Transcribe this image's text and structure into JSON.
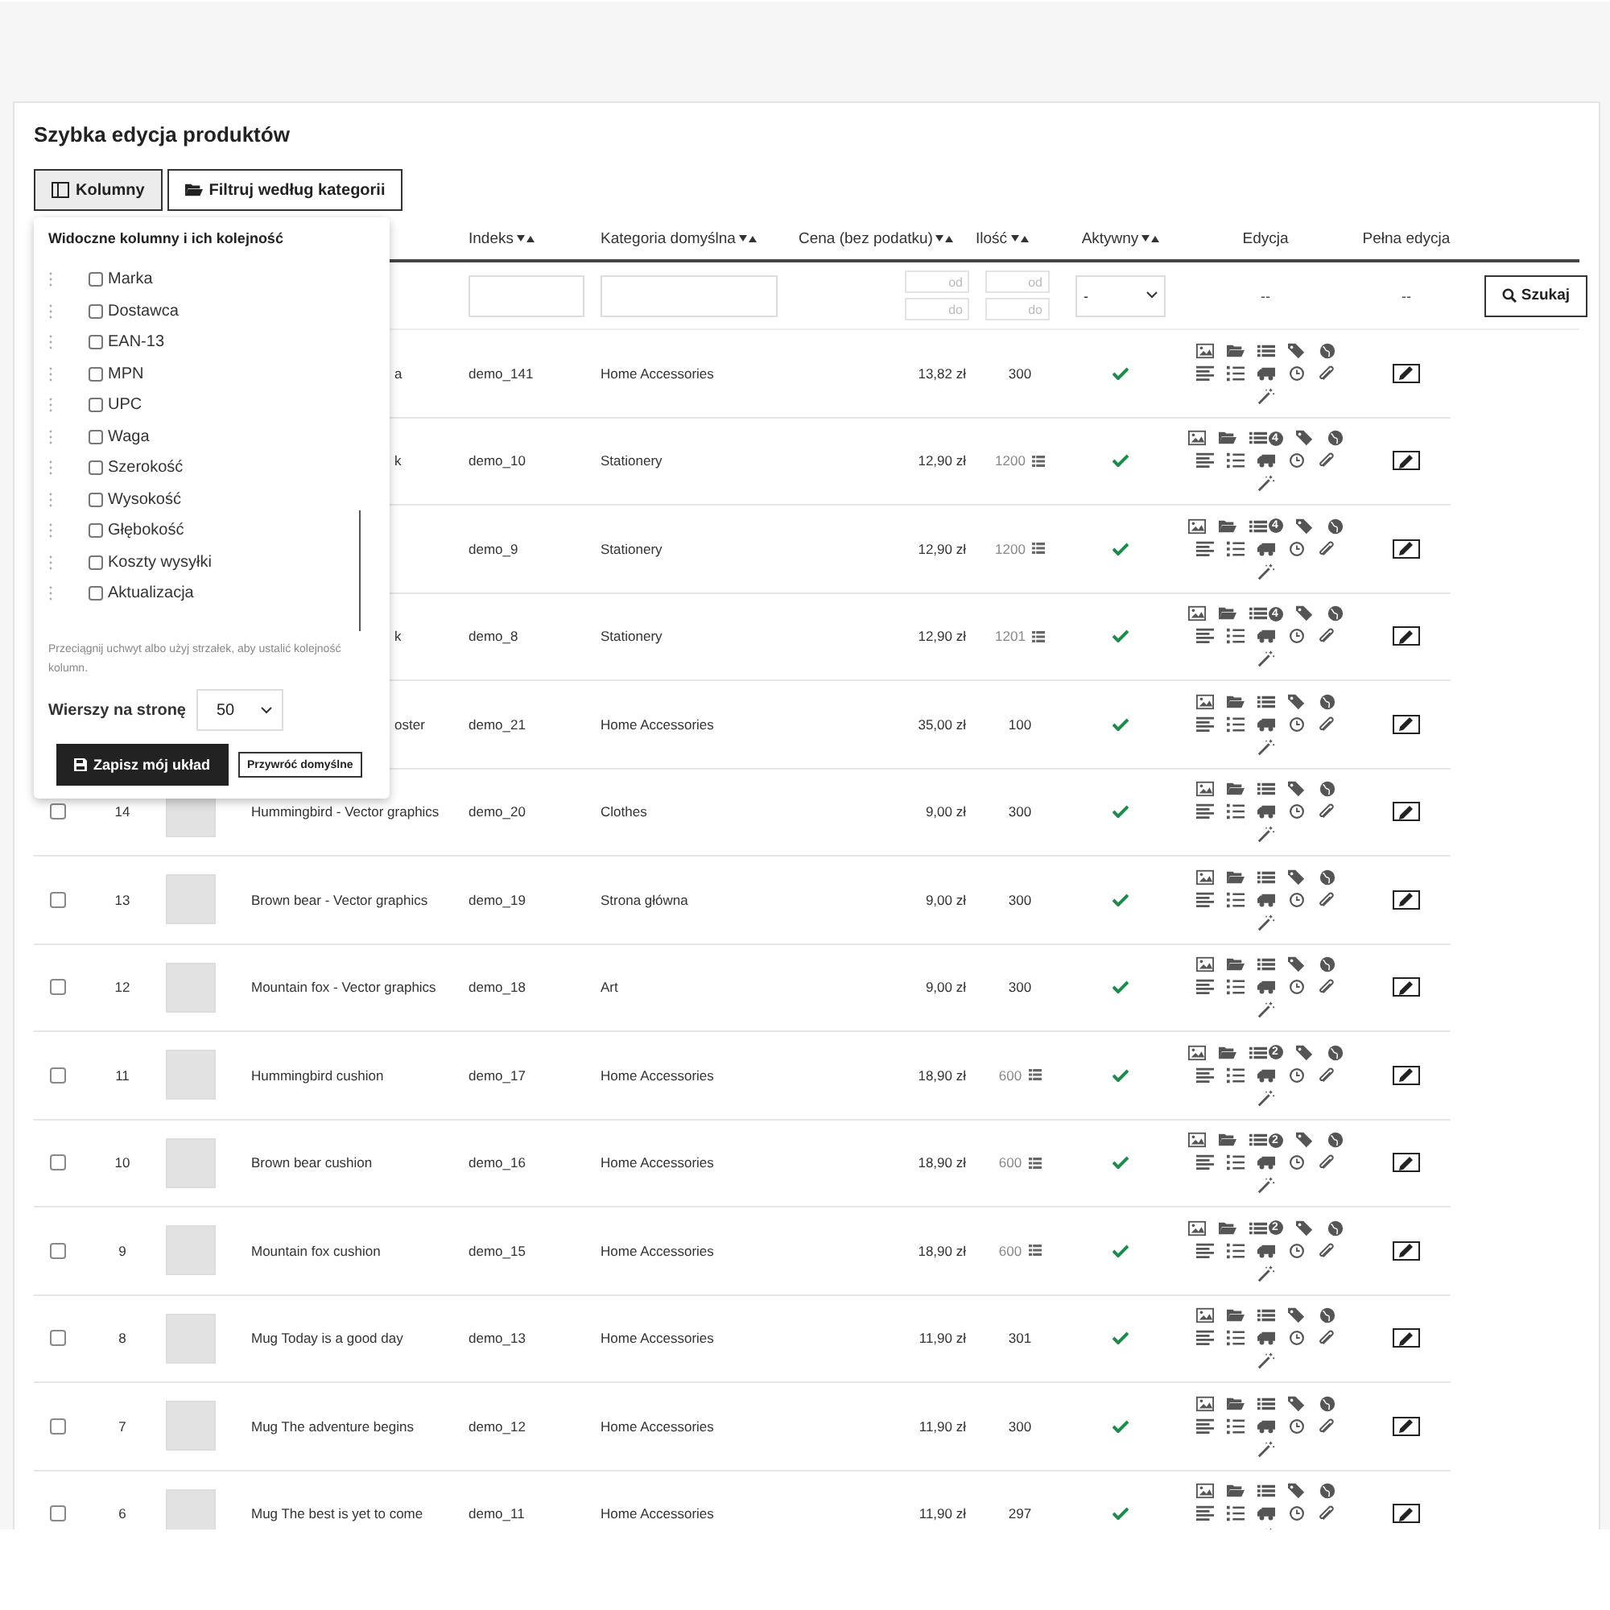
{
  "page": {
    "title": "Szybka edycja produktów"
  },
  "toolbar": [
    {
      "kind": "columns",
      "label": "Kolumny",
      "selected": true
    },
    {
      "kind": "category",
      "label": "Filtruj według kategorii",
      "selected": false
    }
  ],
  "columns_panel": {
    "title": "Widoczne kolumny i ich kolejność",
    "items": [
      {
        "label": "Marka",
        "checked": false
      },
      {
        "label": "Dostawca",
        "checked": false
      },
      {
        "label": "EAN-13",
        "checked": false
      },
      {
        "label": "MPN",
        "checked": false
      },
      {
        "label": "UPC",
        "checked": false
      },
      {
        "label": "Waga",
        "checked": false
      },
      {
        "label": "Szerokość",
        "checked": false
      },
      {
        "label": "Wysokość",
        "checked": false
      },
      {
        "label": "Głębokość",
        "checked": false
      },
      {
        "label": "Koszty wysyłki",
        "checked": false
      },
      {
        "label": "Aktualizacja",
        "checked": false
      }
    ],
    "hint": "Przeciągnij uchwyt albo użyj strzałek, aby ustalić kolejność kolumn.",
    "rows_per_page_label": "Wierszy na stronę",
    "rows_per_page": "50",
    "save_button": "Zapisz mój układ",
    "reset_button": "Przywróć domyślne"
  },
  "table": {
    "columns": [
      {
        "label": "Indeks",
        "sortable": true
      },
      {
        "label": "Kategoria domyślna",
        "sortable": true
      },
      {
        "label": "Cena (bez podatku)",
        "sortable": true
      },
      {
        "label": "Ilość",
        "sortable": true
      },
      {
        "label": "Aktywny",
        "sortable": true
      },
      {
        "label": "Edycja",
        "sortable": false
      },
      {
        "label": "Pełna edycja",
        "sortable": false
      }
    ],
    "filters": {
      "price_range": [
        {
          "placeholder": "od"
        },
        {
          "placeholder": "do"
        }
      ],
      "quantity_range": [
        {
          "placeholder": "od"
        },
        {
          "placeholder": "do"
        }
      ],
      "active": "-",
      "edit": "--",
      "full_edit": "--",
      "search_button": "Szukaj"
    },
    "rows": [
      {
        "kind": "covered",
        "name": "a",
        "reference": "demo_141",
        "category": "Home Accessories",
        "price": "13,82 zł",
        "quantity": "300",
        "combinations": false,
        "active": true
      },
      {
        "kind": "covered",
        "name": "k",
        "reference": "demo_10",
        "category": "Stationery",
        "price": "12,90 zł",
        "quantity": "1200",
        "combinations": true,
        "badge": "4",
        "active": true
      },
      {
        "kind": "covered",
        "reference": "demo_9",
        "category": "Stationery",
        "price": "12,90 zł",
        "quantity": "1200",
        "combinations": true,
        "badge": "4",
        "active": true
      },
      {
        "kind": "covered",
        "name": "k",
        "reference": "demo_8",
        "category": "Stationery",
        "price": "12,90 zł",
        "quantity": "1201",
        "combinations": true,
        "badge": "4",
        "active": true
      },
      {
        "kind": "covered",
        "name": "oster",
        "reference": "demo_21",
        "category": "Home Accessories",
        "price": "35,00 zł",
        "quantity": "100",
        "combinations": false,
        "active": true
      },
      {
        "kind": "full",
        "selected": false,
        "id": "14",
        "name": "Hummingbird - Vector graphics",
        "reference": "demo_20",
        "category": "Clothes",
        "price": "9,00 zł",
        "quantity": "300",
        "combinations": false,
        "active": true
      },
      {
        "kind": "full",
        "selected": false,
        "id": "13",
        "name": "Brown bear - Vector graphics",
        "reference": "demo_19",
        "category": "Strona główna",
        "price": "9,00 zł",
        "quantity": "300",
        "combinations": false,
        "active": true
      },
      {
        "kind": "full",
        "selected": false,
        "id": "12",
        "name": "Mountain fox - Vector graphics",
        "reference": "demo_18",
        "category": "Art",
        "price": "9,00 zł",
        "quantity": "300",
        "combinations": false,
        "active": true
      },
      {
        "kind": "full",
        "selected": false,
        "id": "11",
        "name": "Hummingbird cushion",
        "reference": "demo_17",
        "category": "Home Accessories",
        "price": "18,90 zł",
        "quantity": "600",
        "combinations": true,
        "badge": "2",
        "active": true
      },
      {
        "kind": "full",
        "selected": false,
        "id": "10",
        "name": "Brown bear cushion",
        "reference": "demo_16",
        "category": "Home Accessories",
        "price": "18,90 zł",
        "quantity": "600",
        "combinations": true,
        "badge": "2",
        "active": true
      },
      {
        "kind": "full",
        "selected": false,
        "id": "9",
        "name": "Mountain fox cushion",
        "reference": "demo_15",
        "category": "Home Accessories",
        "price": "18,90 zł",
        "quantity": "600",
        "combinations": true,
        "badge": "2",
        "active": true
      },
      {
        "kind": "full",
        "selected": false,
        "id": "8",
        "name": "Mug Today is a good day",
        "reference": "demo_13",
        "category": "Home Accessories",
        "price": "11,90 zł",
        "quantity": "301",
        "combinations": false,
        "active": true
      },
      {
        "kind": "full",
        "selected": false,
        "id": "7",
        "name": "Mug The adventure begins",
        "reference": "demo_12",
        "category": "Home Accessories",
        "price": "11,90 zł",
        "quantity": "300",
        "combinations": false,
        "active": true
      },
      {
        "kind": "full",
        "selected": false,
        "id": "6",
        "name": "Mug The best is yet to come",
        "reference": "demo_11",
        "category": "Home Accessories",
        "price": "11,90 zł",
        "quantity": "297",
        "combinations": false,
        "active": true
      }
    ]
  }
}
